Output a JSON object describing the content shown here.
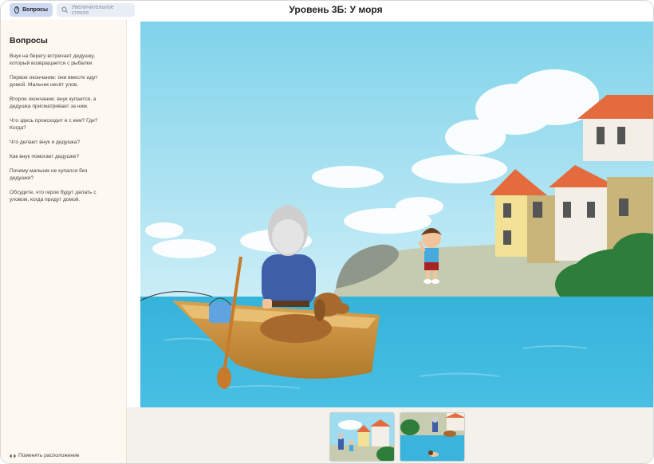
{
  "toolbar": {
    "questions_label": "Вопросы",
    "magnifier_label": "Увеличительное стекло"
  },
  "header": {
    "title": "Уровень 3Б: У моря"
  },
  "sidebar": {
    "title": "Вопросы",
    "items": [
      "Внук на берегу встречает дедушку, который возвращается с рыбалки.",
      "Первое окончание: они вместе идут домой. Мальчик несёт улов.",
      "Второе окончание: внук купается, а дедушка присматривает за ним.",
      "Что здесь происходит и с кем? Где? Когда?",
      "Что делают внук и дедушка?",
      "Как внук помогает дедушке?",
      "Почему мальчик не купался без дедушки?",
      "Обсудите, что герои будут делать с уловом, когда придут домой."
    ],
    "footer_label": "Поменять расположение"
  },
  "colors": {
    "sky_top": "#7fd3ea",
    "sea": "#3ab4dc",
    "roof": "#e36b3d",
    "tab_active": "#cdd9f1",
    "sidebar_bg": "#fdf8f0"
  },
  "icons": {
    "questions": "question-circle-icon",
    "magnifier": "magnifier-icon",
    "swap": "swap-arrows-icon"
  }
}
